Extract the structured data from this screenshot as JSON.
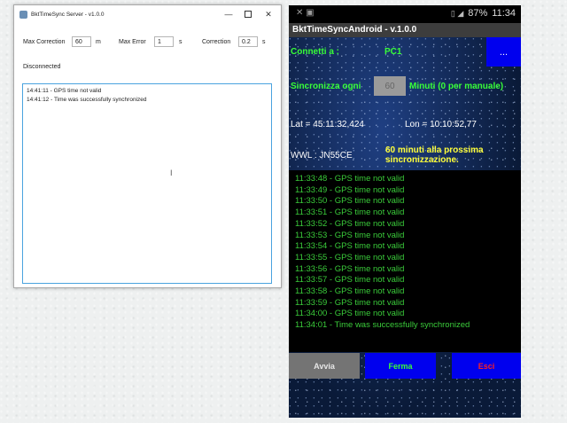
{
  "server_window": {
    "title": "BktTimeSync Server - v1.0.0",
    "controls": {
      "minimize": "—",
      "close": "✕"
    },
    "max_correction": {
      "label": "Max Correction",
      "value": "60",
      "unit": "m"
    },
    "max_error": {
      "label": "Max Error",
      "value": "1",
      "unit": "s"
    },
    "correction": {
      "label": "Correction",
      "value": "0.2",
      "unit": "s"
    },
    "status": "Disconnected",
    "log": [
      "14:41:11 - GPS time not valid",
      "14:41:12 - Time was successfully synchronized"
    ],
    "cursor": "I"
  },
  "android": {
    "statusbar": {
      "left_icons": "✕ ▣",
      "signal_icons": "▯ ◢",
      "battery": "87%",
      "time": "11:34"
    },
    "appbar_title": "BktTimeSyncAndroid - v.1.0.0",
    "connect_label": "Connetti a :",
    "connect_value": "PC1",
    "connect_button": "...",
    "sync_label": "Sincronizza ogni",
    "sync_value": "60",
    "sync_unit": "Minuti (0 per manuale)",
    "lat": "Lat = 45:11:32,424",
    "lon": "Lon = 10:10:52,77",
    "wwl": "WWL : JN55CE",
    "next_sync": "60 minuti alla prossima sincronizzazione.",
    "log": [
      "11:33:48 - GPS time not valid",
      "11:33:49 - GPS time not valid",
      "11:33:50 - GPS time not valid",
      "11:33:51 - GPS time not valid",
      "11:33:52 - GPS time not valid",
      "11:33:53 - GPS time not valid",
      "11:33:54 - GPS time not valid",
      "11:33:55 - GPS time not valid",
      "11:33:56 - GPS time not valid",
      "11:33:57 - GPS time not valid",
      "11:33:58 - GPS time not valid",
      "11:33:59 - GPS time not valid",
      "11:34:00 - GPS time not valid",
      "11:34:01 - Time was successfully synchronized"
    ],
    "buttons": {
      "start": "Avvia",
      "stop": "Ferma",
      "exit": "Esci"
    },
    "colors": {
      "label_green": "#38ff38",
      "log_green": "#3acc3a",
      "button_blue": "#0000ee",
      "exit_red": "#ff2020",
      "info_yellow": "#ffff3a"
    }
  }
}
